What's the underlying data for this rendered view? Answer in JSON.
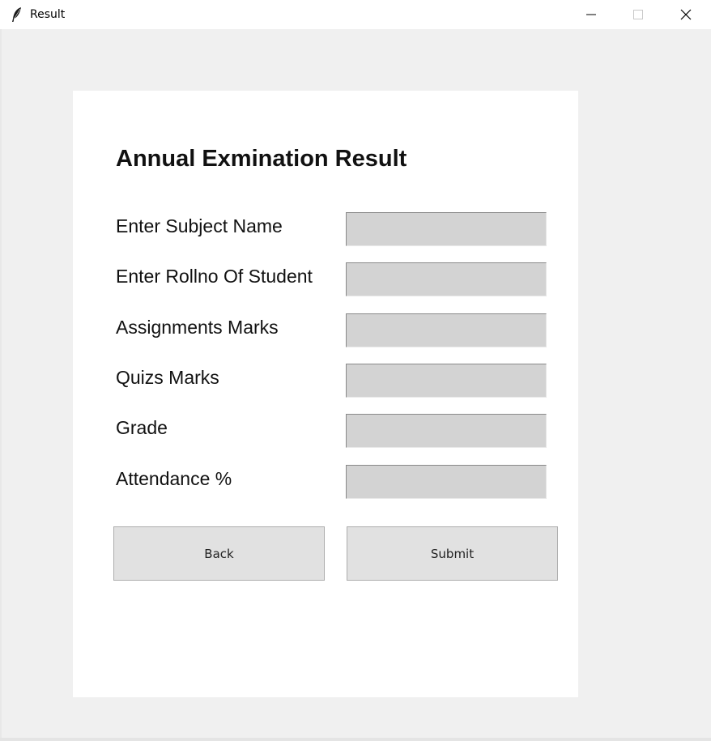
{
  "window": {
    "title": "Result",
    "app_icon": "feather-icon",
    "controls": [
      "minimize-icon",
      "maximize-icon",
      "close-icon"
    ]
  },
  "form": {
    "heading": "Annual Exmination Result",
    "fields": [
      {
        "label": "Enter Subject Name",
        "value": ""
      },
      {
        "label": "Enter Rollno Of Student",
        "value": ""
      },
      {
        "label": "Assignments Marks",
        "value": ""
      },
      {
        "label": "Quizs Marks",
        "value": ""
      },
      {
        "label": "Grade",
        "value": ""
      },
      {
        "label": "Attendance %",
        "value": ""
      }
    ],
    "back_label": "Back",
    "submit_label": "Submit"
  },
  "colors": {
    "window_bg": "#f0f0f0",
    "panel_bg": "#ffffff",
    "input_bg": "#d3d3d3",
    "button_bg": "#e1e1e1",
    "button_border": "#adadad"
  }
}
